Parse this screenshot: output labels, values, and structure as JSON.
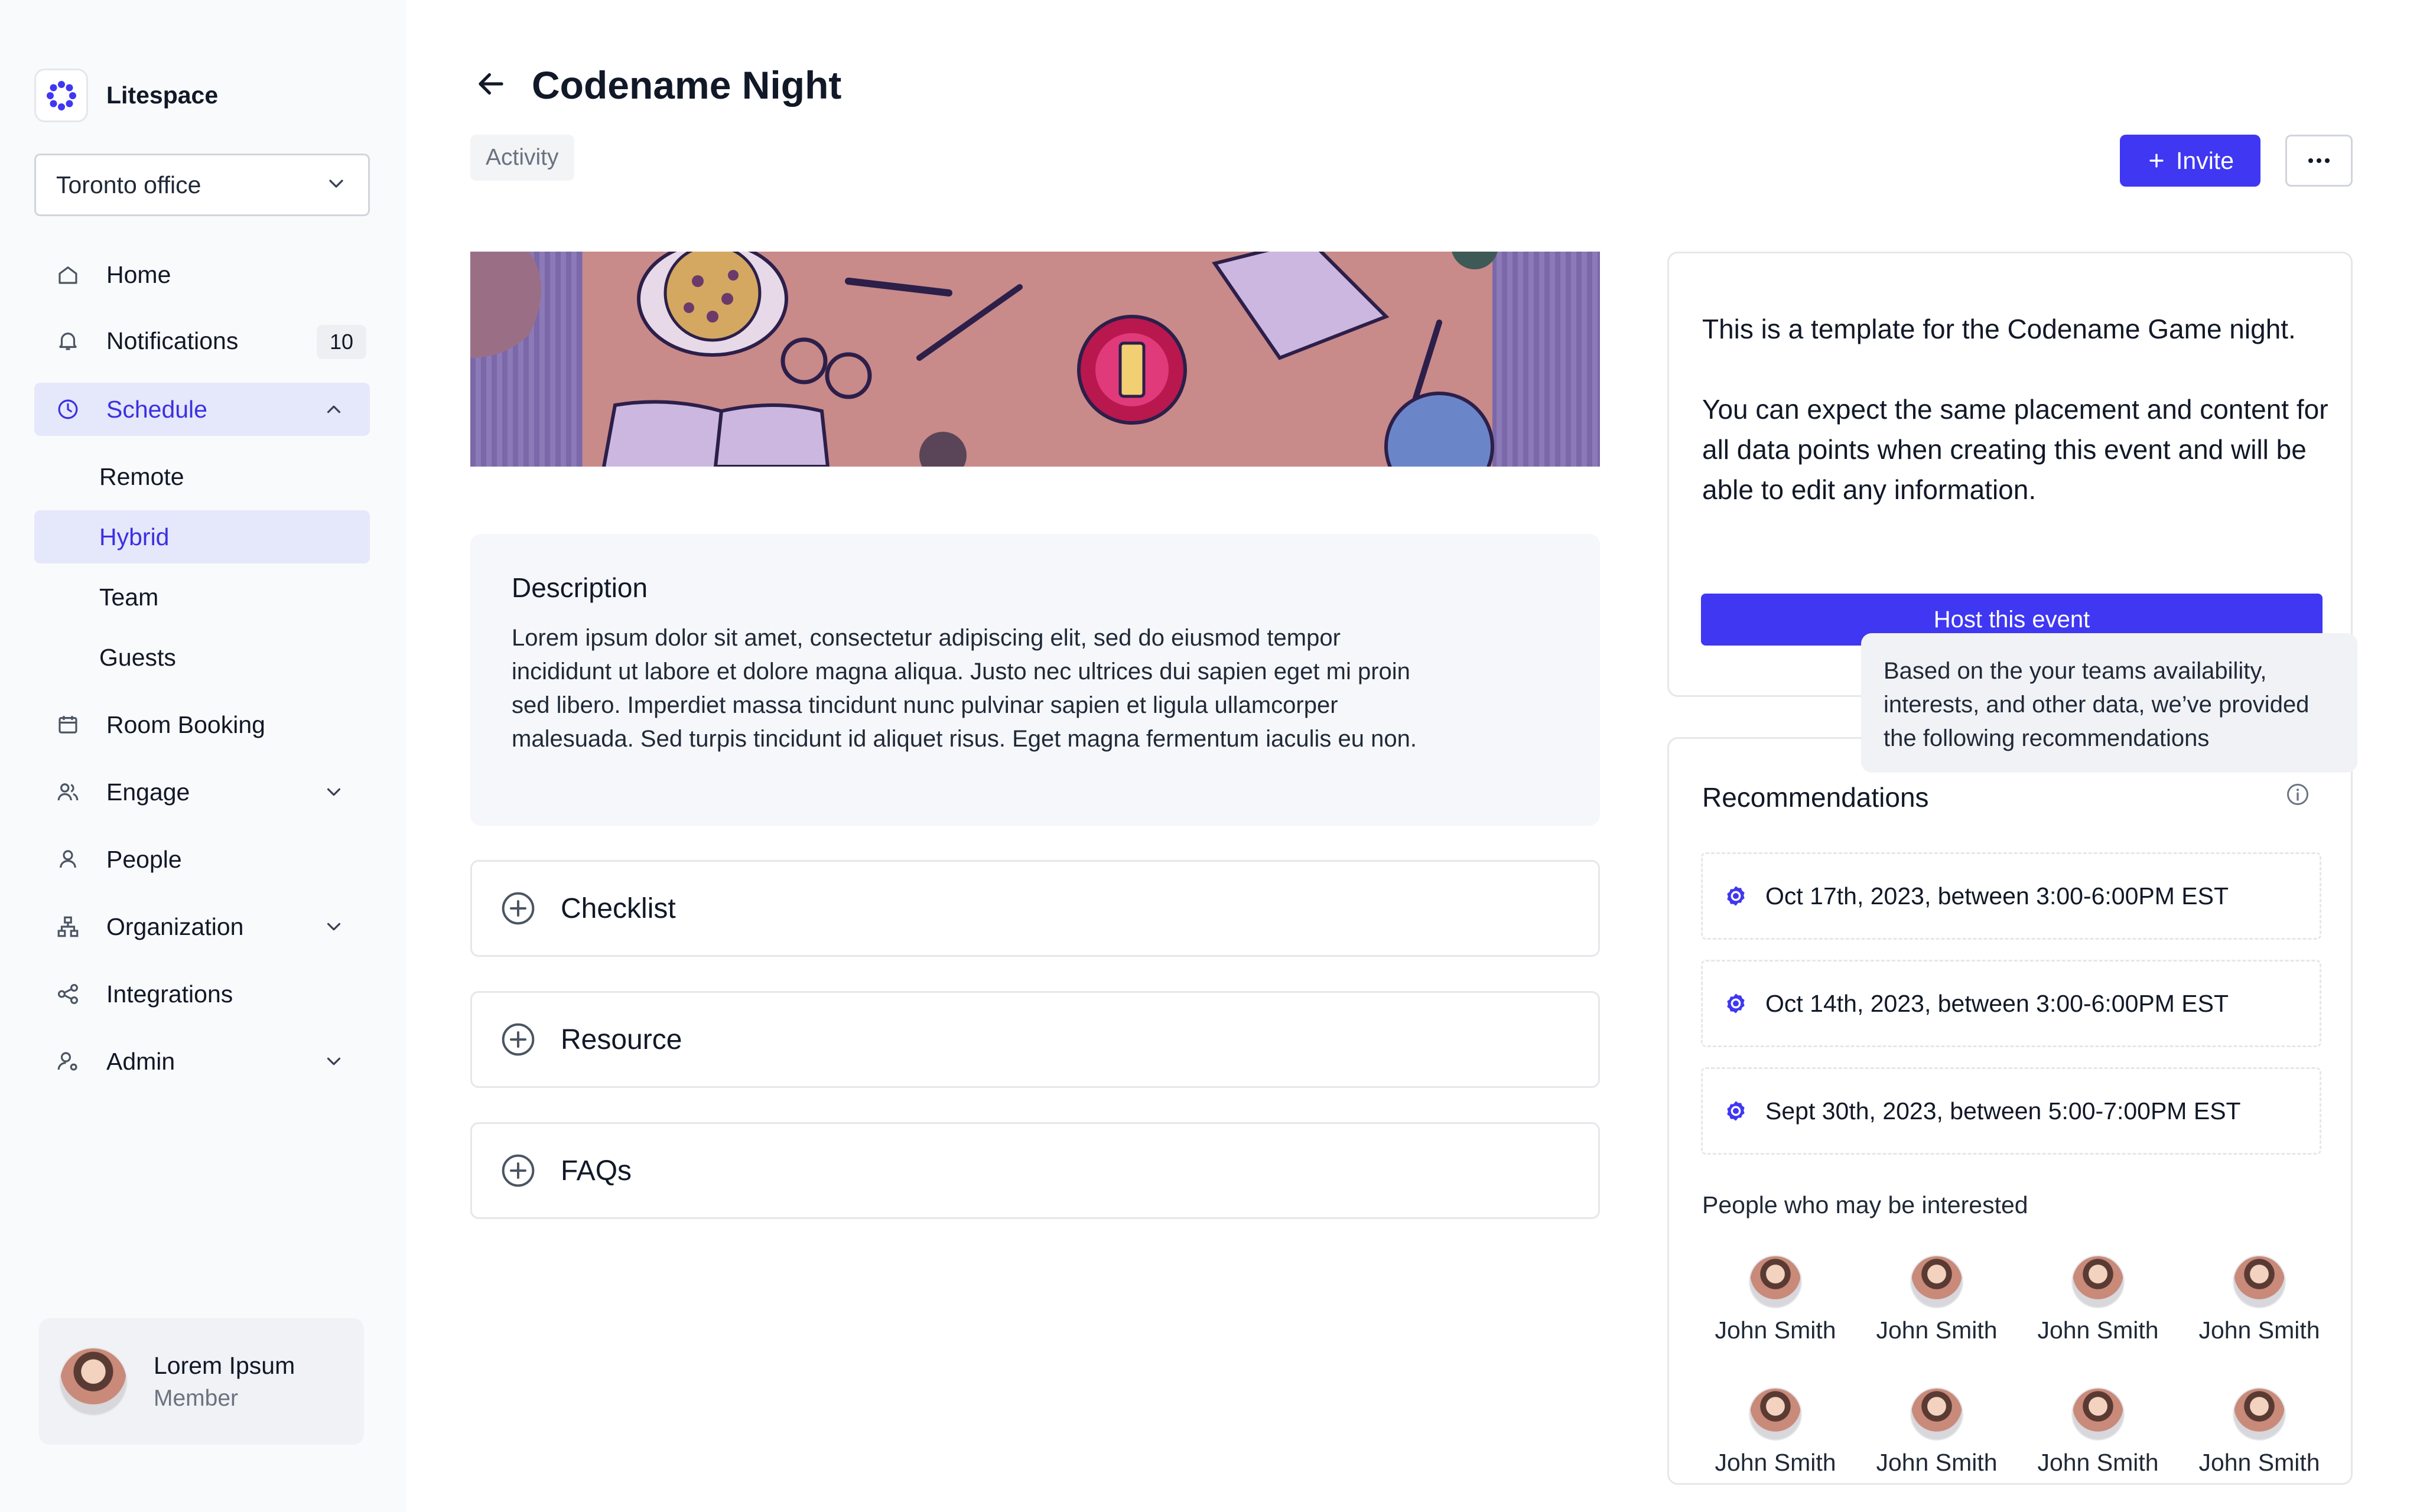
{
  "app": {
    "name": "Litespace"
  },
  "sidebar": {
    "office_select": {
      "value": "Toronto office"
    },
    "items": [
      {
        "label": "Home"
      },
      {
        "label": "Notifications",
        "badge": "10"
      },
      {
        "label": "Schedule",
        "subitems": [
          "Remote",
          "Hybrid",
          "Team",
          "Guests"
        ]
      },
      {
        "label": "Room Booking"
      },
      {
        "label": "Engage"
      },
      {
        "label": "People"
      },
      {
        "label": "Organization"
      },
      {
        "label": "Integrations"
      },
      {
        "label": "Admin"
      }
    ],
    "profile": {
      "name": "Lorem Ipsum",
      "role": "Member"
    }
  },
  "header": {
    "title": "Codename Night",
    "tag": "Activity",
    "invite_label": "Invite",
    "more_label": "···"
  },
  "description": {
    "title": "Description",
    "body": "Lorem ipsum dolor sit amet, consectetur adipiscing elit, sed do eiusmod tempor incididunt ut labore et dolore magna aliqua. Justo nec ultrices dui sapien eget mi proin sed libero. Imperdiet massa tincidunt nunc pulvinar sapien et ligula ullamcorper malesuada. Sed turpis tincidunt id aliquet risus. Eget magna fermentum iaculis eu non."
  },
  "accordions": [
    "Checklist",
    "Resource",
    "FAQs"
  ],
  "template_card": {
    "text": "This is a template for the Codename Game night.\n\nYou can expect the same placement and content for all data points when creating this event and will be able to edit any information.",
    "host_label": "Host this event"
  },
  "tooltip": {
    "text": "Based on the your teams availability, interests, and other data, we’ve provided the following recommendations"
  },
  "recommendations": {
    "title": "Recommendations",
    "items": [
      "Oct 17th, 2023, between 3:00-6:00PM EST",
      "Oct 14th, 2023, between 3:00-6:00PM EST",
      "Sept 30th, 2023, between 5:00-7:00PM EST"
    ],
    "people_title": "People who may be interested",
    "people": [
      "John Smith",
      "John Smith",
      "John Smith",
      "John Smith",
      "John Smith",
      "John Smith",
      "John Smith",
      "John Smith"
    ]
  },
  "colors": {
    "accent": "#3f37f2",
    "active_bg": "#e5e7fb",
    "sidebar_bg": "#f9fafb"
  }
}
